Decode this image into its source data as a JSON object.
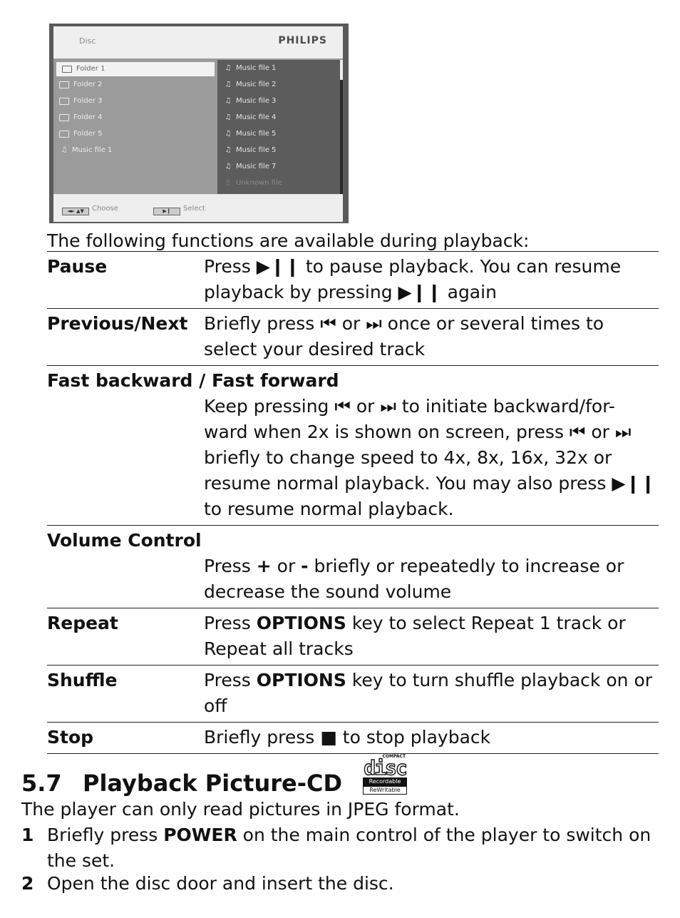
{
  "screenshot": {
    "header_title": "Disc",
    "brand": "PHILIPS",
    "folders": [
      {
        "label": "Folder 1",
        "icon": "folder-open-icon",
        "selected": true
      },
      {
        "label": "Folder 2",
        "icon": "folder-icon",
        "selected": false
      },
      {
        "label": "Folder 3",
        "icon": "folder-icon",
        "selected": false
      },
      {
        "label": "Folder 4",
        "icon": "folder-icon",
        "selected": false
      },
      {
        "label": "Folder 5",
        "icon": "folder-icon",
        "selected": false
      },
      {
        "label": "Music file 1",
        "icon": "music-file-icon",
        "selected": false
      }
    ],
    "files": [
      {
        "label": "Music file 1",
        "icon": "music-file-icon"
      },
      {
        "label": "Music file 2",
        "icon": "music-file-icon"
      },
      {
        "label": "Music file 3",
        "icon": "music-file-icon"
      },
      {
        "label": "Music file 4",
        "icon": "music-file-icon"
      },
      {
        "label": "Music file 5",
        "icon": "music-file-icon"
      },
      {
        "label": "Music file 5",
        "icon": "music-file-icon"
      },
      {
        "label": "Music file 7",
        "icon": "music-file-icon"
      },
      {
        "label": "Unknown file",
        "icon": "unknown-file-icon"
      }
    ],
    "footer": {
      "choose_key": "◄► ▲▼",
      "choose_label": "Choose",
      "select_key": "▶❙",
      "select_label": "Select"
    }
  },
  "intro": "The following functions are available during playback:",
  "functions": [
    {
      "term": "Pause",
      "parts": [
        "Press ",
        "▶❙❙",
        " to pause playback. You can resume playback by pressing ",
        "▶❙❙",
        " again"
      ]
    },
    {
      "term": "Previous/Next",
      "parts": [
        "Briefly press ",
        "⏮",
        " or ",
        "⏭",
        " once or several times to select your desired track"
      ]
    },
    {
      "term": "Fast backward / Fast forward",
      "parts": [
        "Keep pressing ",
        "⏮",
        " or ",
        "⏭",
        " to initiate backward/for-ward when 2x is shown on screen, press ",
        "⏮",
        "  or ",
        "⏭",
        " briefly to change speed to 4x, 8x, 16x, 32x or resume normal playback. You may also press ",
        "▶❙❙",
        " to resume normal playback."
      ]
    },
    {
      "term": "Volume Control",
      "parts": [
        "Press ",
        "+",
        " or ",
        "-",
        " briefly or repeatedly to increase or decrease the sound volume"
      ]
    },
    {
      "term": "Repeat",
      "parts": [
        "Press ",
        "OPTIONS",
        " key to select Repeat 1 track or Repeat all tracks"
      ]
    },
    {
      "term": "Shuffle",
      "parts": [
        "Press ",
        "OPTIONS",
        " key to turn shuffle playback on or off"
      ]
    },
    {
      "term": "Stop",
      "parts": [
        "Briefly press ",
        "■",
        " to stop playback"
      ]
    }
  ],
  "section": {
    "number": "5.7",
    "title": "Playback Picture-CD",
    "logo": {
      "top": "COMPACT",
      "word": "disc",
      "line1": "Recordable",
      "line2": "ReWritable"
    },
    "intro": "The player can only read pictures in JPEG format.",
    "steps": [
      {
        "n": "1",
        "parts": [
          "Briefly press ",
          "POWER",
          " on the main control of the player to switch on the set."
        ]
      },
      {
        "n": "2",
        "parts": [
          "Open the disc door and insert the disc."
        ]
      }
    ]
  }
}
